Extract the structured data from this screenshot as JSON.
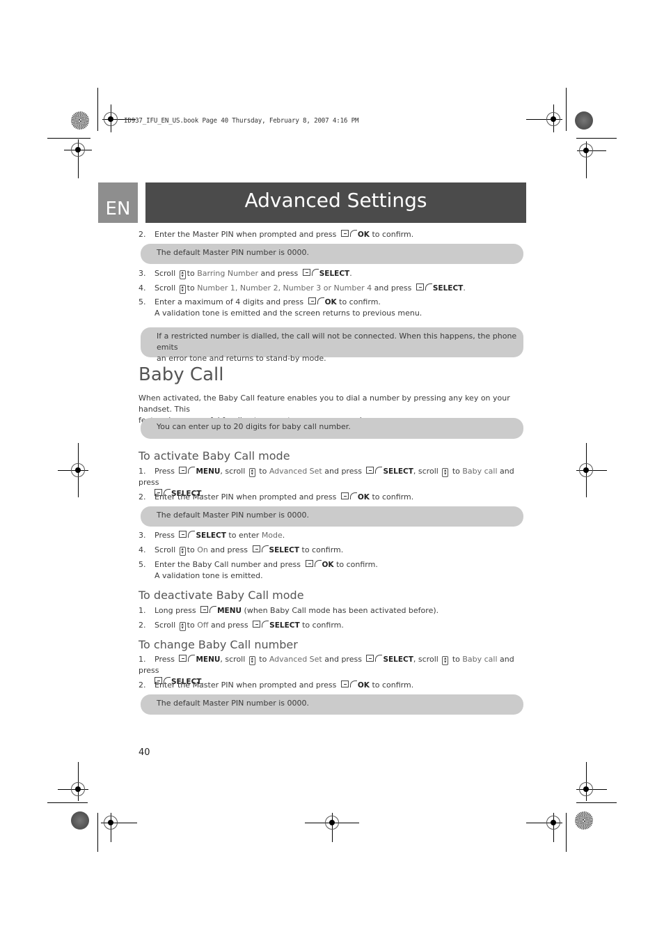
{
  "print_header": "ID937_IFU_EN_US.book  Page 40  Thursday, February 8, 2007  4:16 PM",
  "language_tab": "EN",
  "page_title": "Advanced Settings",
  "barring_continued": {
    "step2": {
      "num": "2.",
      "pre": "Enter the Master PIN when prompted and press",
      "key": "OK",
      "post": "to confirm."
    },
    "note1": "The default Master PIN number is 0000.",
    "step3": {
      "num": "3.",
      "pre": "Scroll",
      "mid": "to",
      "target": "Barring Number",
      "mid2": "and press",
      "key": "SELECT",
      "post": "."
    },
    "step4": {
      "num": "4.",
      "pre": "Scroll",
      "mid": "to",
      "target": "Number 1, Number 2, Number 3 or Number 4",
      "mid2": "and press",
      "key": "SELECT",
      "post": "."
    },
    "step5": {
      "num": "5.",
      "pre": "Enter a maximum of 4 digits and press",
      "key": "OK",
      "post": "to confirm.",
      "line2": "A validation tone is emitted and the screen returns to previous menu."
    },
    "note2_line1": "If a restricted number is dialled, the call will not be connected. When this happens, the phone emits",
    "note2_line2": "an error tone and returns to stand-by mode."
  },
  "baby_call": {
    "heading": "Baby Call",
    "intro_line1": "When activated, the Baby Call feature enables you to dial a number by pressing any key on your handset. This",
    "intro_line2": "feature is very useful for direct access to emergency services.",
    "note": "You can enter up to 20 digits for baby call number.",
    "activate": {
      "heading": "To activate Baby Call mode",
      "step1": {
        "num": "1.",
        "press": "Press",
        "menu": "MENU",
        "scroll": ", scroll",
        "to": "to",
        "adv": "Advanced Set",
        "andpress": "and press",
        "select": "SELECT",
        "scroll2": ", scroll",
        "to2": "to",
        "baby": "Baby call",
        "andpress2": "and press",
        "select2": "SELECT",
        "end": "."
      },
      "step2": {
        "num": "2.",
        "pre": "Enter the Master PIN when prompted and press",
        "key": "OK",
        "post": "to confirm."
      },
      "note": "The default Master PIN number is 0000.",
      "step3": {
        "num": "3.",
        "pre": "Press",
        "key": "SELECT",
        "mid": "to enter",
        "target": "Mode",
        "post": "."
      },
      "step4": {
        "num": "4.",
        "pre": "Scroll",
        "mid": "to",
        "target": "On",
        "mid2": "and press",
        "key": "SELECT",
        "post": "to confirm."
      },
      "step5": {
        "num": "5.",
        "pre": "Enter the Baby Call number and press",
        "key": "OK",
        "post": "to confirm.",
        "line2": "A validation tone is emitted."
      }
    },
    "deactivate": {
      "heading": "To deactivate Baby Call mode",
      "step1": {
        "num": "1.",
        "pre": "Long press",
        "key": "MENU",
        "post": "(when Baby Call mode has been activated before)."
      },
      "step2": {
        "num": "2.",
        "pre": "Scroll",
        "mid": "to",
        "target": "Off",
        "mid2": "and press",
        "key": "SELECT",
        "post": "to confirm."
      }
    },
    "change": {
      "heading": "To change Baby Call number",
      "step1": {
        "num": "1.",
        "press": "Press",
        "menu": "MENU",
        "scroll": ", scroll",
        "to": "to",
        "adv": "Advanced Set",
        "andpress": "and press",
        "select": "SELECT",
        "scroll2": ", scroll",
        "to2": "to",
        "baby": "Baby call",
        "andpress2": "and press",
        "select2": "SELECT",
        "end": "."
      },
      "step2": {
        "num": "2.",
        "pre": "Enter the Master PIN when prompted and press",
        "key": "OK",
        "post": "to confirm."
      },
      "note": "The default Master PIN number is 0000."
    }
  },
  "page_number": "40",
  "colors": {
    "title_bar": "#4b4b4b",
    "lang_tab": "#8e8e8e",
    "note_bg": "#cbcbcb",
    "highlight_text": "#6b6b6b"
  }
}
